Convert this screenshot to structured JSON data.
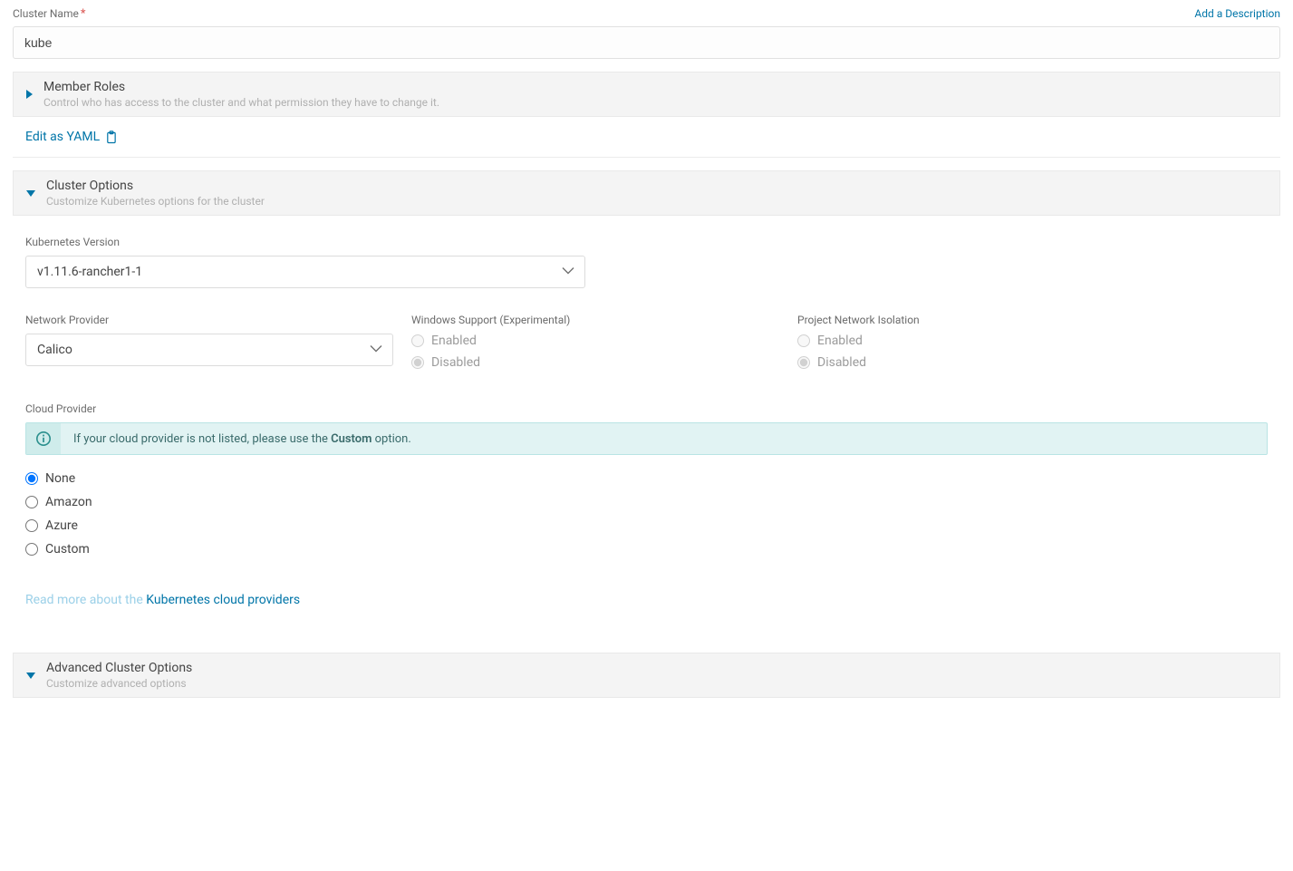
{
  "labels": {
    "cluster_name": "Cluster Name",
    "add_description": "Add a Description"
  },
  "cluster_name_value": "kube",
  "sections": {
    "member_roles": {
      "title": "Member Roles",
      "subtitle": "Control who has access to the cluster and what permission they have to change it."
    },
    "cluster_options": {
      "title": "Cluster Options",
      "subtitle": "Customize Kubernetes options for the cluster"
    },
    "advanced": {
      "title": "Advanced Cluster Options",
      "subtitle": "Customize advanced options"
    }
  },
  "edit_as_yaml": "Edit as YAML",
  "k8s_version": {
    "label": "Kubernetes Version",
    "value": "v1.11.6-rancher1-1"
  },
  "network_provider": {
    "label": "Network Provider",
    "value": "Calico"
  },
  "windows_support": {
    "label": "Windows Support (Experimental)",
    "enabled": "Enabled",
    "disabled": "Disabled"
  },
  "project_isolation": {
    "label": "Project Network Isolation",
    "enabled": "Enabled",
    "disabled": "Disabled"
  },
  "cloud_provider": {
    "label": "Cloud Provider",
    "banner_prefix": "If your cloud provider is not listed, please use the ",
    "banner_bold": "Custom",
    "banner_suffix": " option.",
    "options": {
      "none": "None",
      "amazon": "Amazon",
      "azure": "Azure",
      "custom": "Custom"
    }
  },
  "read_more": {
    "prefix": "Read more about the ",
    "link": "Kubernetes cloud providers"
  }
}
